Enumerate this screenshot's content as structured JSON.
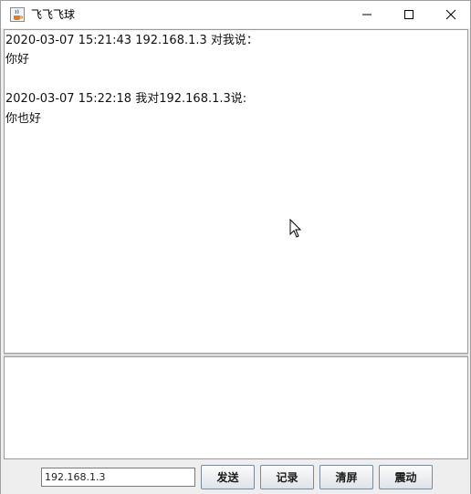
{
  "window": {
    "title": "飞飞飞球",
    "app_icon": "java-cup-icon",
    "controls": [
      "minimize-icon",
      "maximize-icon",
      "close-icon"
    ]
  },
  "chat": {
    "messages": [
      {
        "header": "2020-03-07 15:21:43 192.168.1.3 对我说：",
        "body": "你好"
      },
      {
        "header": "2020-03-07 15:22:18 我对192.168.1.3说:",
        "body": "你也好"
      }
    ]
  },
  "input": {
    "value": ""
  },
  "bottom_bar": {
    "ip_value": "192.168.1.3",
    "send_label": "发送",
    "record_label": "记录",
    "clear_label": "清屏",
    "shake_label": "震动"
  },
  "colors": {
    "window_bg": "#eeeeee",
    "text_area_bg": "#ffffff",
    "border": "#9a9a9a"
  }
}
